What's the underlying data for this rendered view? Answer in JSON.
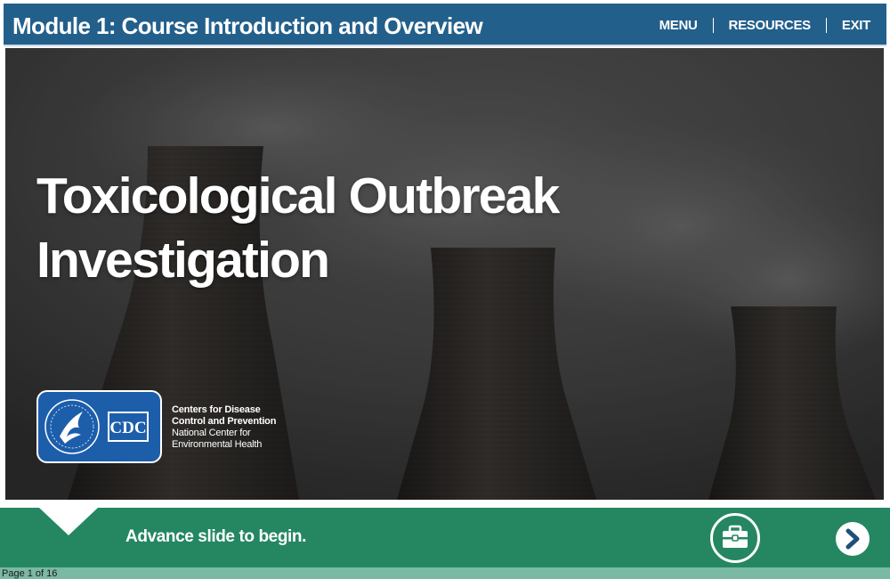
{
  "header": {
    "module_title": "Module 1: Course Introduction and Overview",
    "nav": {
      "menu": "MENU",
      "resources": "RESOURCES",
      "exit": "EXIT"
    }
  },
  "slide": {
    "title_line1": "Toxicological Outbreak",
    "title_line2": "Investigation",
    "background_image": "cooling-towers-smoke"
  },
  "branding": {
    "logo": "HHS eagle + CDC logo",
    "logo_text": "CDC",
    "org_line1": "Centers for Disease",
    "org_line2": "Control and Prevention",
    "center_line1": "National Center for",
    "center_line2": "Environmental Health"
  },
  "footer": {
    "instruction": "Advance slide to begin.",
    "toolkit_icon": "toolbox-icon",
    "next_icon": "chevron-right-icon"
  },
  "page_indicator": "Page 1 of 16",
  "colors": {
    "header_blue": "#235f8b",
    "footer_green": "#248762",
    "page_bar_green": "#7ab9a3",
    "logo_blue": "#1d5eab",
    "next_arrow_blue": "#1f4e79"
  }
}
